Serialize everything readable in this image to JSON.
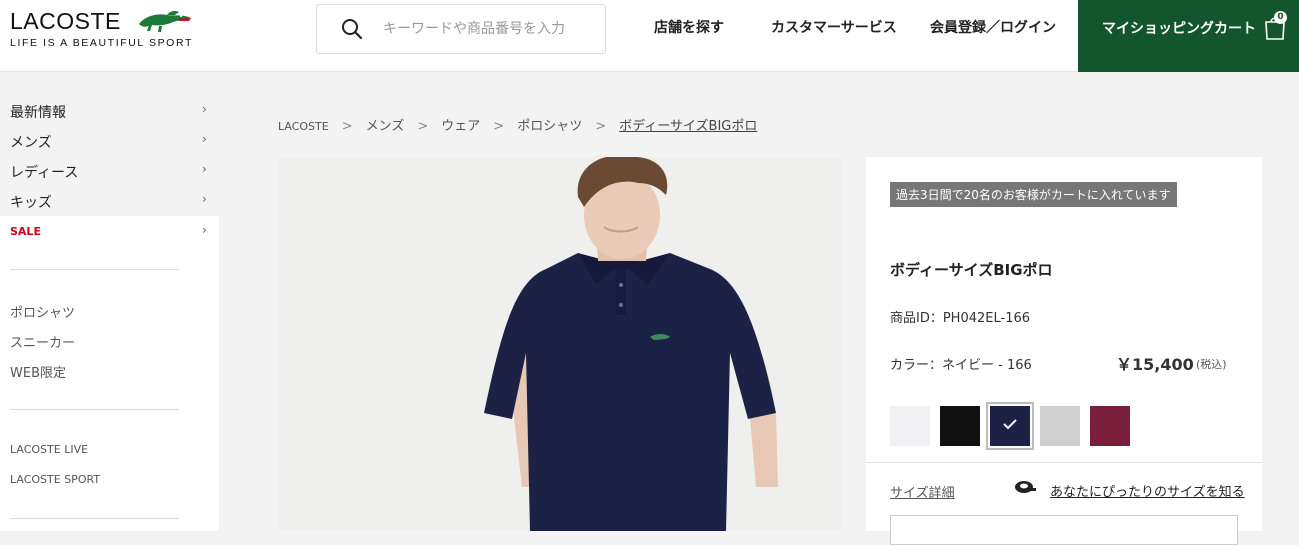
{
  "header": {
    "logo_text": "LACOSTE",
    "logo_tagline": "LIFE IS A BEAUTIFUL SPORT",
    "search_placeholder": "キーワードや商品番号を入力",
    "nav": {
      "stores": "店舗を探す",
      "customer_service": "カスタマーサービス",
      "login": "会員登録／ログイン"
    },
    "cart_label": "マイショッピングカート",
    "cart_count": "0"
  },
  "sidebar": {
    "categories": [
      {
        "label": "最新情報"
      },
      {
        "label": "メンズ"
      },
      {
        "label": "レディース"
      },
      {
        "label": "キッズ"
      },
      {
        "label": "SALE"
      }
    ],
    "links": [
      "ポロシャツ",
      "スニーカー",
      "WEB限定"
    ],
    "brand_links": [
      "LACOSTE LIVE",
      "LACOSTE SPORT"
    ]
  },
  "breadcrumb": [
    "LACOSTE",
    "メンズ",
    "ウェア",
    "ポロシャツ",
    "ボディーサイズBIGポロ"
  ],
  "product": {
    "notice": "過去3日間で20名のお客様がカートに入れています",
    "title": "ボディーサイズBIGポロ",
    "id_label": "商品ID：PH042EL-166",
    "color_label": "カラー：ネイビー - 166",
    "price": "￥15,400",
    "tax_note": "(税込)",
    "swatches": [
      {
        "color": "#f1f1f3"
      },
      {
        "color": "#111111"
      },
      {
        "color": "#1c2146",
        "selected": true
      },
      {
        "color": "#cfcfcf"
      },
      {
        "color": "#7a1f3b"
      }
    ],
    "size_detail": "サイズ詳細",
    "fit_link": "あなたにぴったりのサイズを知る"
  },
  "colors": {
    "brand_green": "#13552d",
    "sale_red": "#d0021b"
  }
}
